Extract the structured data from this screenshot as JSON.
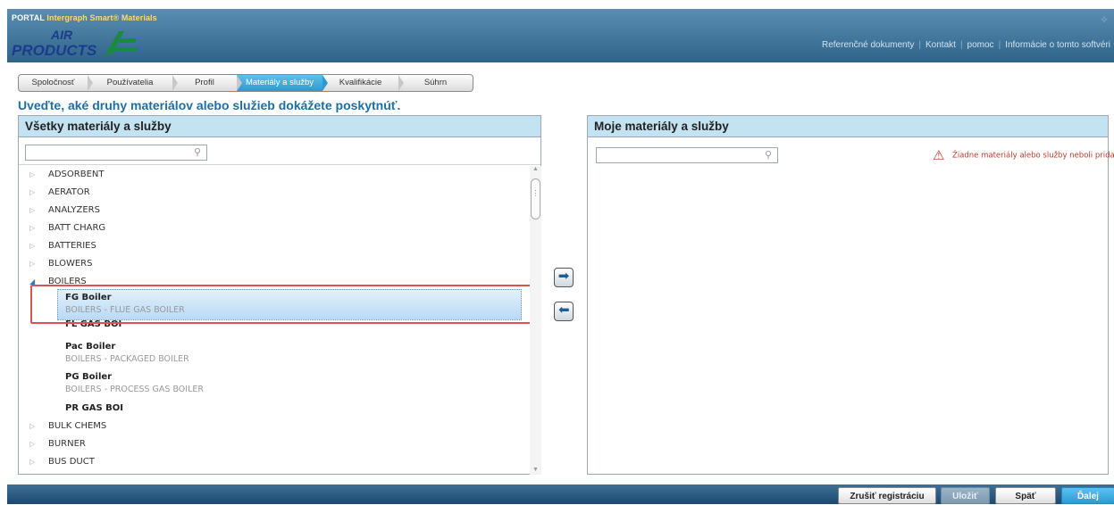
{
  "header": {
    "portal_label": "PORTAL",
    "product_name": "Intergraph Smart® Materials",
    "logo_text_top": "AIR",
    "logo_text_bottom": "PRODUCTS",
    "links": [
      "Referenčné dokumenty",
      "Kontakt",
      "pomoc",
      "Informácie o tomto softvéri"
    ]
  },
  "steps": [
    {
      "label": "Spoločnosť",
      "active": false
    },
    {
      "label": "Používatelia",
      "active": false
    },
    {
      "label": "Profil",
      "active": false
    },
    {
      "label": "Materiály a služby",
      "active": true
    },
    {
      "label": "Kvalifikácie",
      "active": false
    },
    {
      "label": "Súhrn",
      "active": false
    }
  ],
  "instruction": "Uveďte, aké druhy materiálov alebo služieb dokážete poskytnúť.",
  "left_panel": {
    "title": "Všetky materiály a služby",
    "search_placeholder": "",
    "tree": [
      {
        "label": "ADSORBENT",
        "expanded": false
      },
      {
        "label": "AERATOR",
        "expanded": false
      },
      {
        "label": "ANALYZERS",
        "expanded": false
      },
      {
        "label": "BATT CHARG",
        "expanded": false
      },
      {
        "label": "BATTERIES",
        "expanded": false
      },
      {
        "label": "BLOWERS",
        "expanded": false
      },
      {
        "label": "BOILERS",
        "expanded": true
      },
      {
        "label": "BULK CHEMS",
        "expanded": false
      },
      {
        "label": "BURNER",
        "expanded": false
      },
      {
        "label": "BUS DUCT",
        "expanded": false
      }
    ],
    "children": [
      {
        "name": "FG Boiler",
        "desc": "BOILERS - FLUE GAS BOILER",
        "selected": true
      },
      {
        "name": "FL GAS BOI",
        "desc": ""
      },
      {
        "name": "Pac Boiler",
        "desc": "BOILERS - PACKAGED BOILER"
      },
      {
        "name": "PG Boiler",
        "desc": "BOILERS - PROCESS GAS BOILER"
      },
      {
        "name": "PR GAS BOI",
        "desc": ""
      }
    ]
  },
  "right_panel": {
    "title": "Moje materiály a služby",
    "search_placeholder": "",
    "warning": "Žiadne materiály alebo služby neboli pridané"
  },
  "footer": {
    "cancel": "Zrušiť registráciu",
    "save": "Uložiť",
    "back": "Späť",
    "next": "Ďalej"
  },
  "colors": {
    "header_top": "#5a8db1",
    "header_bottom": "#2f6489",
    "accent": "#2a9bd3",
    "instruction": "#1d6fa5",
    "panel_title_bg": "#c3e3f2",
    "warning": "#c03a2b",
    "highlight": "#d9534f"
  }
}
